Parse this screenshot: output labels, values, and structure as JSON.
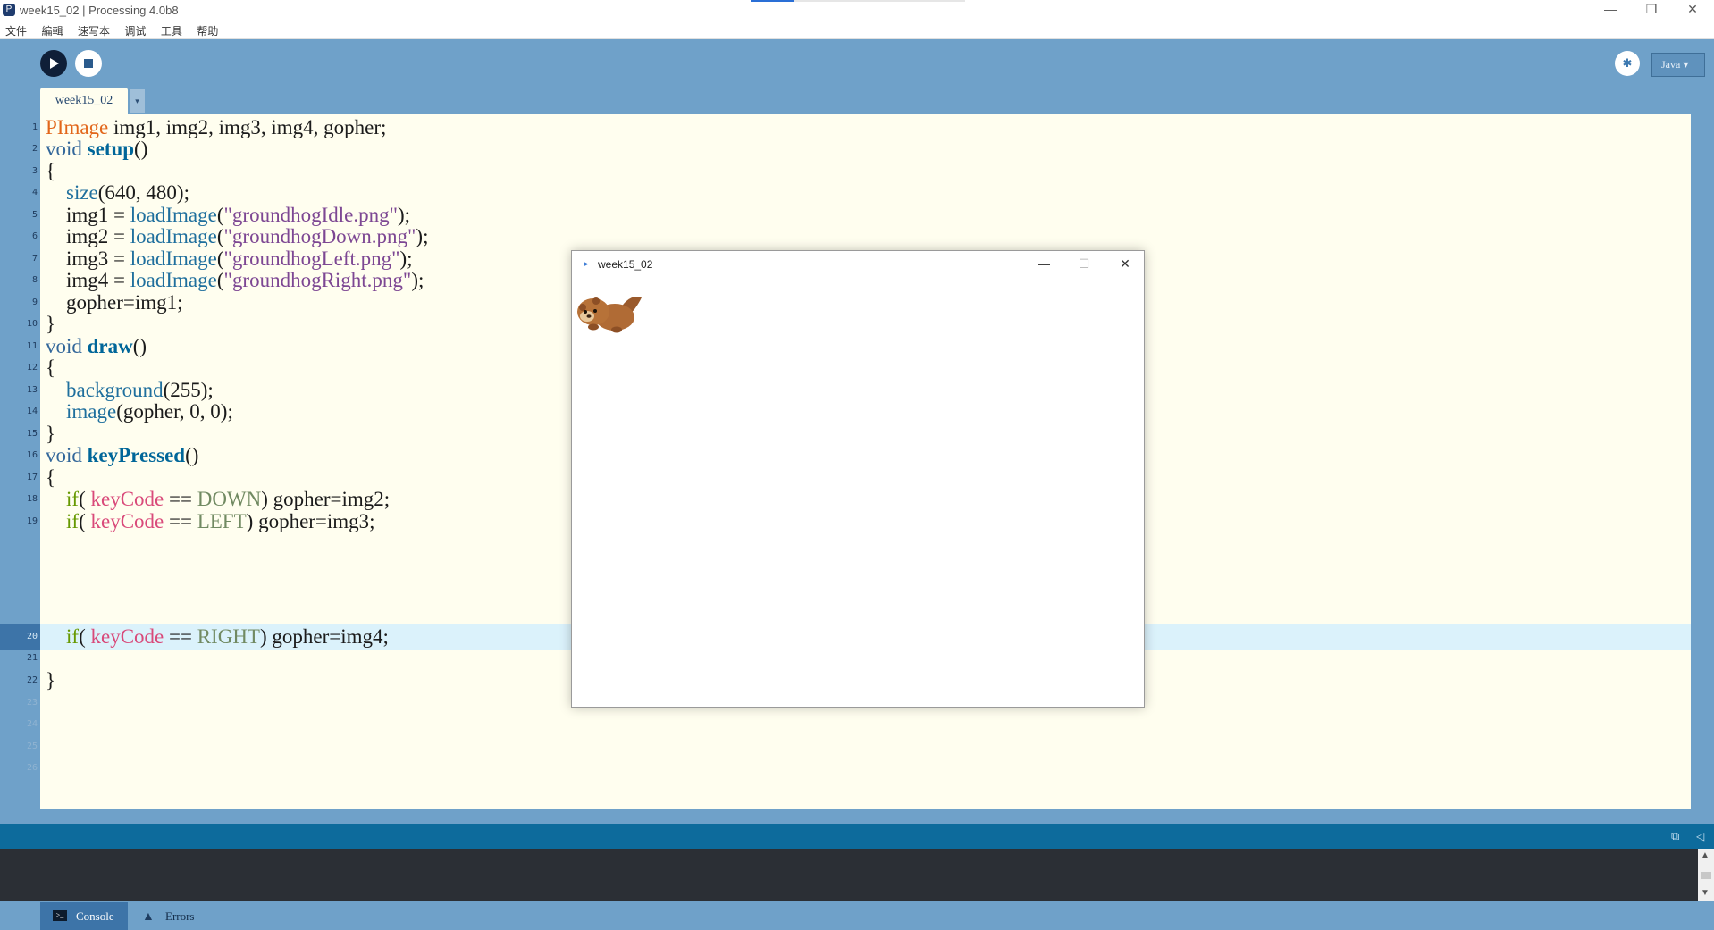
{
  "window": {
    "title": "week15_02 | Processing 4.0b8",
    "minimize": "—",
    "restore": "❐",
    "close": "✕"
  },
  "menu": [
    "文件",
    "編輯",
    "速写本",
    "调试",
    "工具",
    "帮助"
  ],
  "toolbar": {
    "mode": "Java ▾",
    "tab_label": "week15_02",
    "tab_menu": "▾"
  },
  "editor": {
    "current_line": 20,
    "line_numbers": [
      "1",
      "2",
      "3",
      "4",
      "5",
      "6",
      "7",
      "8",
      "9",
      "10",
      "11",
      "12",
      "13",
      "14",
      "15",
      "16",
      "17",
      "18",
      "19",
      "20",
      "21",
      "22",
      "23",
      "24",
      "25",
      "26"
    ]
  },
  "code": {
    "l1": {
      "a": "PImage",
      "b": " img1, img2, img3, img4, gopher;"
    },
    "l2": {
      "a": "void",
      "b": " ",
      "c": "setup",
      "d": "()"
    },
    "l3": {
      "a": "{"
    },
    "l4": {
      "a": "    ",
      "b": "size",
      "c": "(640, 480);"
    },
    "l5": {
      "a": "    img1 = ",
      "b": "loadImage",
      "c": "(",
      "d": "\"groundhogIdle.png\"",
      "e": ");"
    },
    "l6": {
      "a": "    img2 = ",
      "b": "loadImage",
      "c": "(",
      "d": "\"groundhogDown.png\"",
      "e": ");"
    },
    "l7": {
      "a": "    img3 = ",
      "b": "loadImage",
      "c": "(",
      "d": "\"groundhogLeft.png\"",
      "e": ");"
    },
    "l8": {
      "a": "    img4 = ",
      "b": "loadImage",
      "c": "(",
      "d": "\"groundhogRight.png\"",
      "e": ");"
    },
    "l9": {
      "a": "    gopher=img1;"
    },
    "l10": {
      "a": "}"
    },
    "l11": {
      "a": "void",
      "b": " ",
      "c": "draw",
      "d": "()"
    },
    "l12": {
      "a": "{"
    },
    "l13": {
      "a": "    ",
      "b": "background",
      "c": "(255);"
    },
    "l14": {
      "a": "    ",
      "b": "image",
      "c": "(gopher, 0, 0);"
    },
    "l15": {
      "a": "}"
    },
    "l16": {
      "a": "void",
      "b": " ",
      "c": "keyPressed",
      "d": "()"
    },
    "l17": {
      "a": "{"
    },
    "l18": {
      "a": "    ",
      "b": "if",
      "c": "( ",
      "d": "keyCode",
      "e": " == ",
      "f": "DOWN",
      "g": ") gopher=img2;"
    },
    "l19": {
      "a": "    ",
      "b": "if",
      "c": "( ",
      "d": "keyCode",
      "e": " == ",
      "f": "LEFT",
      "g": ") gopher=img3;"
    },
    "l20": {
      "a": "    ",
      "b": "if",
      "c": "( ",
      "d": "keyCode",
      "e": " == ",
      "f": "RIGHT",
      "g": ") gopher=img4;"
    },
    "l22": {
      "a": "}"
    }
  },
  "footer": {
    "console_label": "Console",
    "errors_label": "Errors"
  },
  "sketch_window": {
    "title": "week15_02",
    "minimize": "—",
    "maximize": "☐",
    "close": "✕"
  },
  "icons": {
    "run": "play-icon",
    "stop": "stop-icon",
    "debug": "bug-icon",
    "console": "terminal-icon",
    "errors": "warning-icon"
  },
  "colors": {
    "toolbar": "#6fa1c9",
    "editor_bg": "#fffeef",
    "current_line": "#dbf2fb",
    "message_bar": "#0d6b9c",
    "console_bg": "#2b2f35"
  }
}
